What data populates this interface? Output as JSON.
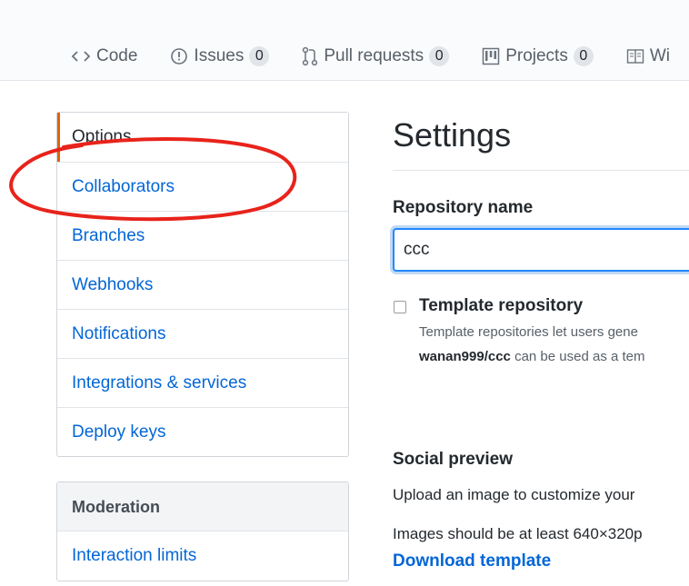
{
  "repo_nav": {
    "tabs": [
      {
        "label": "Code",
        "icon": "code-icon"
      },
      {
        "label": "Issues",
        "count": "0",
        "icon": "issue-icon"
      },
      {
        "label": "Pull requests",
        "count": "0",
        "icon": "pull-request-icon"
      },
      {
        "label": "Projects",
        "count": "0",
        "icon": "project-icon"
      },
      {
        "label": "Wi",
        "icon": "wiki-icon"
      }
    ]
  },
  "sidebar": {
    "items": [
      {
        "label": "Options",
        "selected": true
      },
      {
        "label": "Collaborators"
      },
      {
        "label": "Branches"
      },
      {
        "label": "Webhooks"
      },
      {
        "label": "Notifications"
      },
      {
        "label": "Integrations & services"
      },
      {
        "label": "Deploy keys"
      }
    ],
    "moderation": {
      "heading": "Moderation",
      "items": [
        {
          "label": "Interaction limits"
        }
      ]
    }
  },
  "settings": {
    "title": "Settings",
    "repo_name_label": "Repository name",
    "repo_name_value": "ccc",
    "template_label": "Template repository",
    "template_desc": "Template repositories let users gene",
    "template_desc2_repo": "wanan999/ccc",
    "template_desc2_rest": " can be used as a tem",
    "social_title": "Social preview",
    "social_desc": "Upload an image to customize your",
    "social_size": "Images should be at least 640×320p",
    "download_template": "Download template"
  },
  "colors": {
    "link": "#0366d6",
    "selected_accent": "#e36209",
    "annotation": "#e8231b",
    "focus_border": "#2188ff"
  }
}
